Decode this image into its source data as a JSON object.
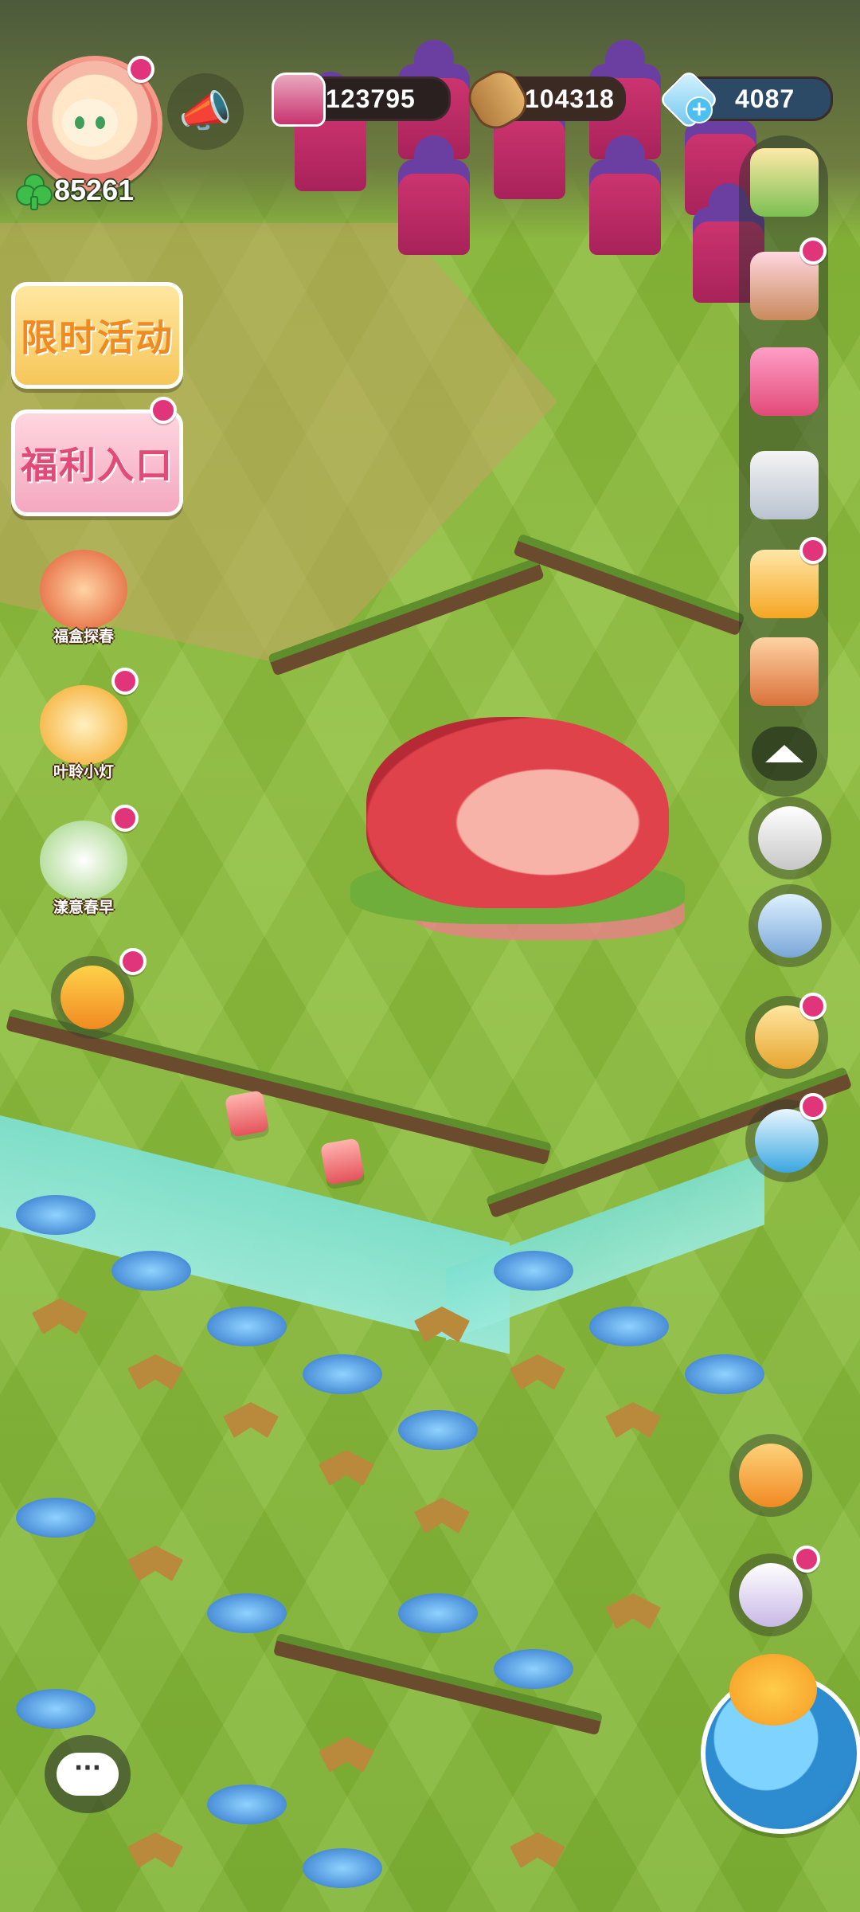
{
  "player": {
    "avatar_icon": "girl-avatar-icon",
    "clover_count": "85261"
  },
  "resources": {
    "jar": "123795",
    "wood": "104318",
    "gems": "4087",
    "gems_plus": "+"
  },
  "left_menu": {
    "limited_event": "限时活动",
    "welfare": "福利入口"
  },
  "side_characters": [
    {
      "label": "福盒探春",
      "icon": "fox-girl-icon"
    },
    {
      "label": "叶聆小灯",
      "icon": "leaf-girl-icon"
    },
    {
      "label": "漾意春早",
      "icon": "green-girl-icon"
    }
  ],
  "right_panel": {
    "icons": [
      "bakery-shop-icon",
      "bear-character-icon",
      "card-book-icon",
      "remote-control-icon",
      "bread-transfer-icon",
      "recipe-book-icon"
    ]
  },
  "right_buttons": [
    "camera-icon",
    "phone-swap-icon",
    "cream-bun-icon",
    "tv-video-icon",
    "heart-buns-icon",
    "quest-clipboard-icon"
  ],
  "chat": {
    "label": "···"
  },
  "colors": {
    "notification": "#e0357a",
    "grass": "#8cbf3f",
    "river": "#8ae5d4",
    "limited_event_text": "#f08a22",
    "welfare_text": "#e24a78"
  }
}
